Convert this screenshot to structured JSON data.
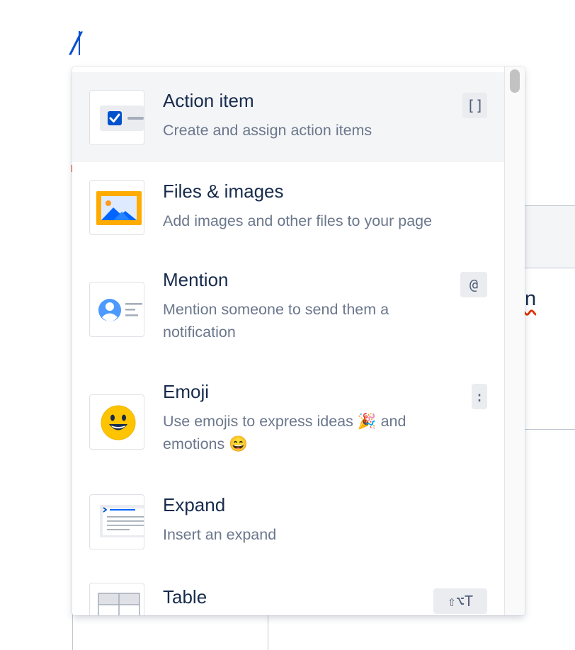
{
  "editor": {
    "slash": "/",
    "partial_text": "n"
  },
  "menu": {
    "items": [
      {
        "title": "Action item",
        "description": "Create and assign action items",
        "shortcut": "[]",
        "icon": "action-item-checkbox-icon",
        "selected": true
      },
      {
        "title": "Files & images",
        "description": "Add images and other files to your page",
        "shortcut": "",
        "icon": "image-icon",
        "selected": false
      },
      {
        "title": "Mention",
        "description": "Mention someone to send them a notification",
        "shortcut": "@",
        "icon": "mention-user-icon",
        "selected": false
      },
      {
        "title": "Emoji",
        "description": "Use emojis to express ideas 🎉 and emotions 😄",
        "shortcut": ":",
        "icon": "smiley-emoji-icon",
        "selected": false
      },
      {
        "title": "Expand",
        "description": "Insert an expand",
        "shortcut": "",
        "icon": "expand-icon",
        "selected": false
      },
      {
        "title": "Table",
        "description": "",
        "shortcut": "⇧⌥T",
        "icon": "table-icon",
        "selected": false
      }
    ]
  },
  "colors": {
    "selected_bg": "#f4f5f7",
    "title": "#172b4d",
    "description": "#6b778c",
    "accent_blue": "#0052cc",
    "image_frame": "#ffab00"
  }
}
